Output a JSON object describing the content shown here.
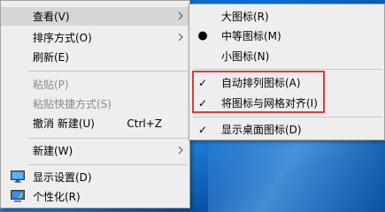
{
  "main_menu": {
    "view": "查看(V)",
    "sort_by": "排序方式(O)",
    "refresh": "刷新(E)",
    "paste": "粘贴(P)",
    "paste_shortcut": "粘贴快捷方式(S)",
    "undo_new": "撤消 新建(U)",
    "undo_shortcut": "Ctrl+Z",
    "new": "新建(W)",
    "display_settings": "显示设置(D)",
    "personalize": "个性化(R)"
  },
  "view_submenu": {
    "large_icons": "大图标(R)",
    "medium_icons": "中等图标(M)",
    "small_icons": "小图标(N)",
    "auto_arrange": "自动排列图标(A)",
    "align_to_grid": "将图标与网格对齐(I)",
    "show_desktop_icons": "显示桌面图标(D)",
    "selected_size": "medium_icons",
    "checked_items": [
      "auto_arrange",
      "align_to_grid",
      "show_desktop_icons"
    ]
  },
  "colors": {
    "menu_bg": "#eeeeee",
    "hover_bg": "#d6d6d6",
    "highlight_border": "#e03b3b",
    "disabled_text": "#8a8a8a"
  }
}
